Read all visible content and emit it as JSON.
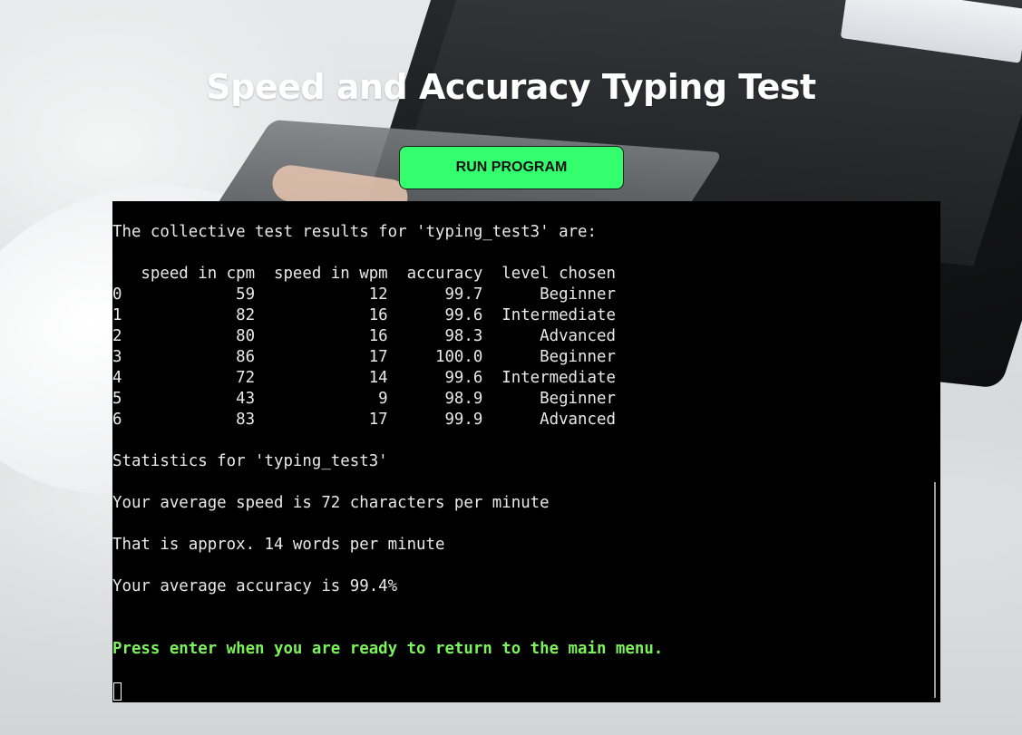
{
  "page": {
    "title": "Speed and Accuracy Typing Test"
  },
  "controls": {
    "run_button_label": "RUN PROGRAM"
  },
  "terminal": {
    "lines": [
      "The collective test results for 'typing_test3' are:",
      "",
      "   speed in cpm  speed in wpm  accuracy  level chosen",
      "0            59            12      99.7      Beginner",
      "1            82            16      99.6  Intermediate",
      "2            80            16      98.3      Advanced",
      "3            86            17     100.0      Beginner",
      "4            72            14      99.6  Intermediate",
      "5            43             9      98.9      Beginner",
      "6            83            17      99.9      Advanced",
      "",
      "Statistics for 'typing_test3'",
      "",
      "Your average speed is 72 characters per minute",
      "",
      "That is approx. 14 words per minute",
      "",
      "Your average accuracy is 99.4%",
      "",
      "",
      "Press enter when you are ready to return to the main menu."
    ],
    "prompt_line_index": 20,
    "colors": {
      "background": "#000000",
      "text": "#e9e9e9",
      "prompt": "#7cf25c"
    }
  },
  "colors": {
    "button": "#33ff6e",
    "title": "#ffffff"
  }
}
